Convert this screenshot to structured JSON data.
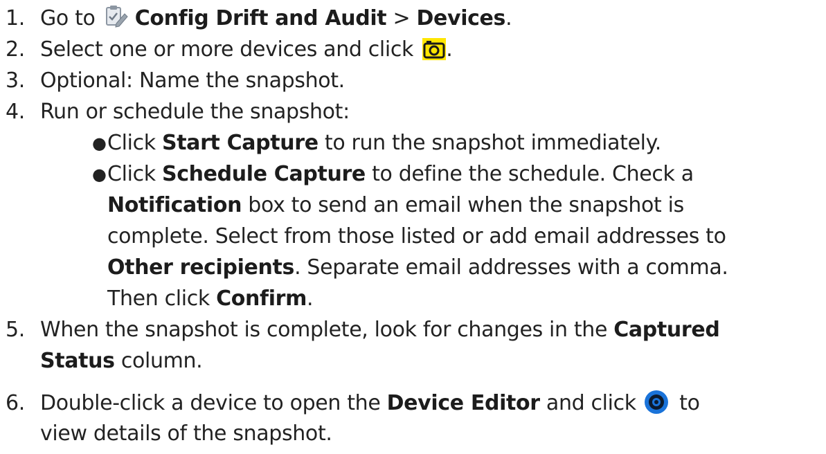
{
  "steps": [
    {
      "num": "1.",
      "a": "Go to",
      "b1": "Config Drift and Audit",
      "c": " > ",
      "b2": "Devices",
      "d": "."
    },
    {
      "num": "2.",
      "a": "Select one or more devices and click",
      "d": "."
    },
    {
      "num": "3.",
      "a": "Optional: Name the snapshot."
    },
    {
      "num": "4.",
      "a": "Run or schedule the snapshot:"
    },
    {
      "num": "5.",
      "a": "When the snapshot is complete, look for changes in the",
      "b1": "Captured",
      "b2": "Status",
      "c": " column."
    },
    {
      "num": "6.",
      "a": "Double-click a device to open the",
      "b1": "Device Editor",
      "c": " and click",
      "d": " to",
      "e": "view details of the snapshot."
    }
  ],
  "bullets": [
    {
      "a": "Click",
      "b1": "Start Capture",
      "c": " to run the snapshot immediately."
    },
    {
      "a": "Click",
      "b1": "Schedule Capture",
      "c": " to define the schedule. Check a",
      "b2": "Notification",
      "d": " box to send an email when the snapshot is",
      "e": "complete. Select from those listed or add email addresses to",
      "b3": "Other recipients",
      "f": ". Separate email addresses with a comma.",
      "g": "Then click",
      "b4": "Confirm",
      "h": "."
    }
  ],
  "icons": {
    "clipboard": "clipboard-edit-icon",
    "camera": "camera-icon",
    "eye": "eye-icon"
  },
  "colors": {
    "text": "#222222",
    "camera_bg": "#ffe600",
    "eye_ring": "#1a73d9"
  }
}
